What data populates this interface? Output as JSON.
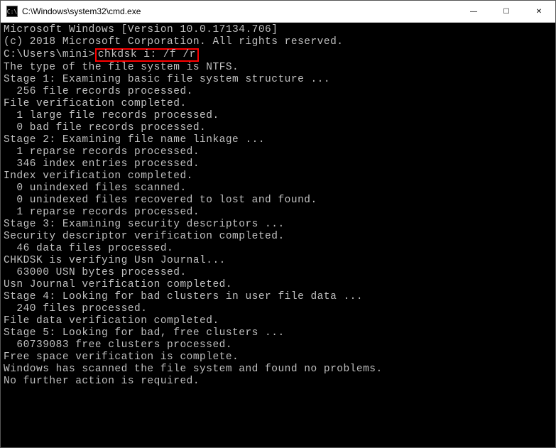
{
  "titlebar": {
    "icon_glyph": "C:\\",
    "title": "C:\\Windows\\system32\\cmd.exe"
  },
  "controls": {
    "minimize": "—",
    "maximize": "☐",
    "close": "✕"
  },
  "terminal": {
    "header_line1": "Microsoft Windows [Version 10.0.17134.706]",
    "header_line2": "(c) 2018 Microsoft Corporation. All rights reserved.",
    "prompt": "C:\\Users\\mini>",
    "command": "chkdsk i: /f /r",
    "lines": [
      "The type of the file system is NTFS.",
      "",
      "Stage 1: Examining basic file system structure ...",
      "  256 file records processed.",
      "File verification completed.",
      "  1 large file records processed.",
      "  0 bad file records processed.",
      "",
      "Stage 2: Examining file name linkage ...",
      "  1 reparse records processed.",
      "  346 index entries processed.",
      "Index verification completed.",
      "  0 unindexed files scanned.",
      "  0 unindexed files recovered to lost and found.",
      "  1 reparse records processed.",
      "",
      "Stage 3: Examining security descriptors ...",
      "Security descriptor verification completed.",
      "  46 data files processed.",
      "CHKDSK is verifying Usn Journal...",
      "  63000 USN bytes processed.",
      "Usn Journal verification completed.",
      "",
      "Stage 4: Looking for bad clusters in user file data ...",
      "  240 files processed.",
      "File data verification completed.",
      "",
      "Stage 5: Looking for bad, free clusters ...",
      "  60739083 free clusters processed.",
      "Free space verification is complete.",
      "",
      "Windows has scanned the file system and found no problems.",
      "No further action is required."
    ]
  }
}
